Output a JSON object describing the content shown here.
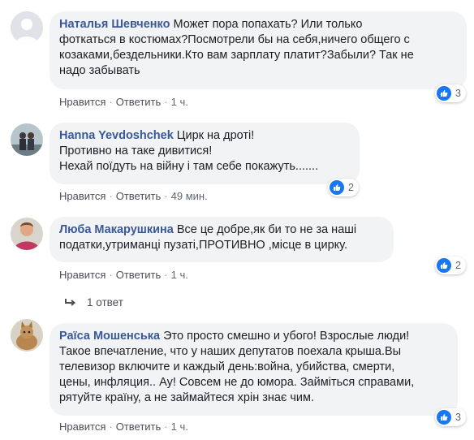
{
  "like_label": "Нравится",
  "reply_label": "Ответить",
  "comments": [
    {
      "author": "Наталья Шевченко",
      "lines": [
        "Может пора попахать? Или только",
        "фоткаться в костюмах?Посмотрели бы на себя,ничего общего с",
        "козаками,бездельники.Кто вам зарплату платит?Забыли? Так не",
        "надо забывать"
      ],
      "time": "1 ч.",
      "reactions": "3",
      "avatar": "default-avatar"
    },
    {
      "author": "Hanna Yevdoshchek",
      "lines": [
        "Цирк на дроті!",
        "Противно на таке дивитися!",
        "Нехай поїдуть на війну і там себе покажуть......."
      ],
      "time": "49 мин.",
      "reactions": "2",
      "avatar": "couple-photo"
    },
    {
      "author": "Люба Макарушкина",
      "lines": [
        "Все це добре,як би то не за наші",
        "податки,утриманці пузаті,ПРОТИВНО ,місце в цирку."
      ],
      "time": "1 ч.",
      "reactions": "2",
      "avatar": "woman-photo",
      "replies": "1 ответ"
    },
    {
      "author": "Раїса Мошенська",
      "lines": [
        "Это просто смешно и убого! Взрослые люди!",
        "Такое впечатление, что у наших депутатов поехала крыша.Вы",
        "телевизор включите и каждый день:война, убийства, смерти,",
        "цены, инфляция.. Ау! Совсем не до юмора. Займіться справами,",
        "рятуйте країну, а не займайтеся хрін знає чим."
      ],
      "time": "1 ч.",
      "reactions": "3",
      "avatar": "cat-photo"
    }
  ]
}
